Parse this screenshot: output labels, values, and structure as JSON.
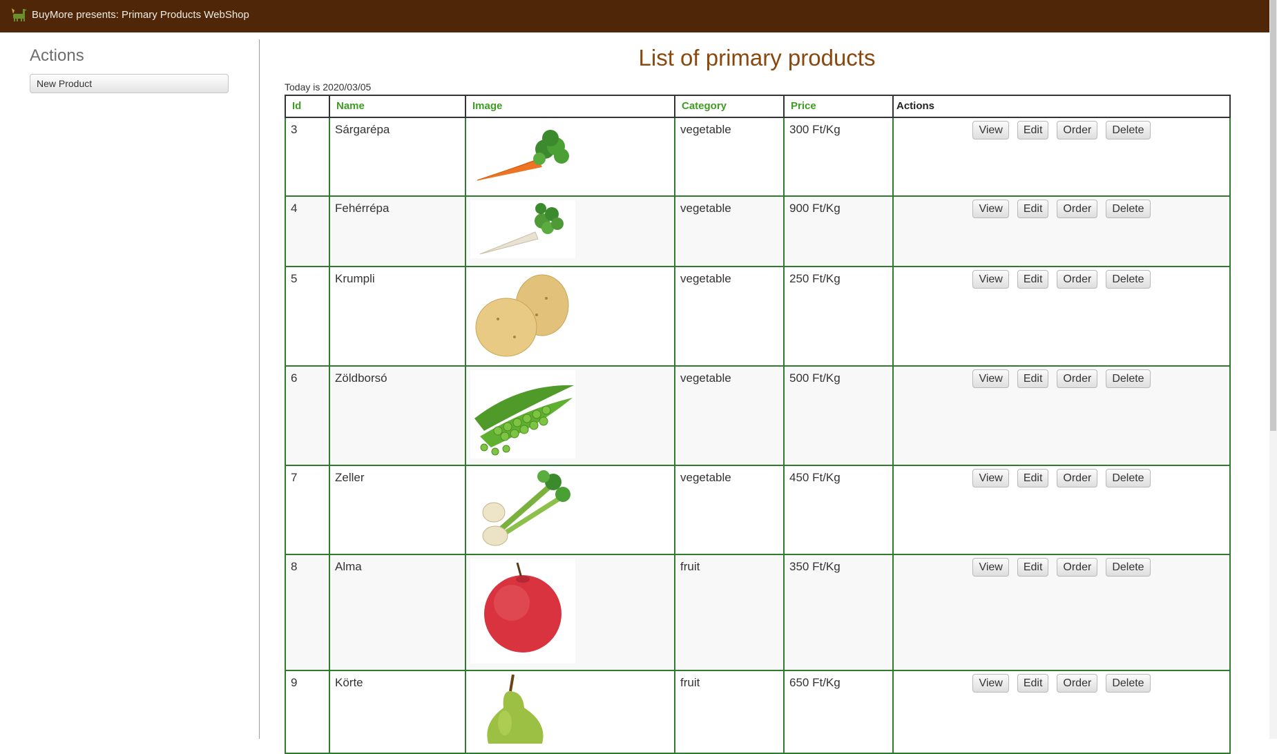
{
  "app": {
    "title": "BuyMore presents: Primary Products WebShop",
    "logo_icon": "llama-icon"
  },
  "sidebar": {
    "heading": "Actions",
    "new_product_label": "New Product"
  },
  "main": {
    "title": "List of primary products",
    "today": "Today is 2020/03/05",
    "columns": [
      "Id",
      "Name",
      "Image",
      "Category",
      "Price",
      "Actions"
    ],
    "action_labels": {
      "view": "View",
      "edit": "Edit",
      "order": "Order",
      "delete": "Delete"
    },
    "rows": [
      {
        "id": "3",
        "name": "Sárgarépa",
        "image": "carrot-image",
        "category": "vegetable",
        "price": "300 Ft/Kg"
      },
      {
        "id": "4",
        "name": "Fehérrépa",
        "image": "parsley-root-image",
        "category": "vegetable",
        "price": "900 Ft/Kg"
      },
      {
        "id": "5",
        "name": "Krumpli",
        "image": "potato-image",
        "category": "vegetable",
        "price": "250 Ft/Kg"
      },
      {
        "id": "6",
        "name": "Zöldborsó",
        "image": "peas-image",
        "category": "vegetable",
        "price": "500 Ft/Kg"
      },
      {
        "id": "7",
        "name": "Zeller",
        "image": "celery-image",
        "category": "vegetable",
        "price": "450 Ft/Kg"
      },
      {
        "id": "8",
        "name": "Alma",
        "image": "apple-image",
        "category": "fruit",
        "price": "350 Ft/Kg"
      },
      {
        "id": "9",
        "name": "Körte",
        "image": "pear-image",
        "category": "fruit",
        "price": "650 Ft/Kg"
      }
    ]
  },
  "colors": {
    "header_bg": "#4f2608",
    "title_color": "#89480e",
    "column_header_color": "#3d9c21",
    "table_border": "#2f7a2f"
  }
}
